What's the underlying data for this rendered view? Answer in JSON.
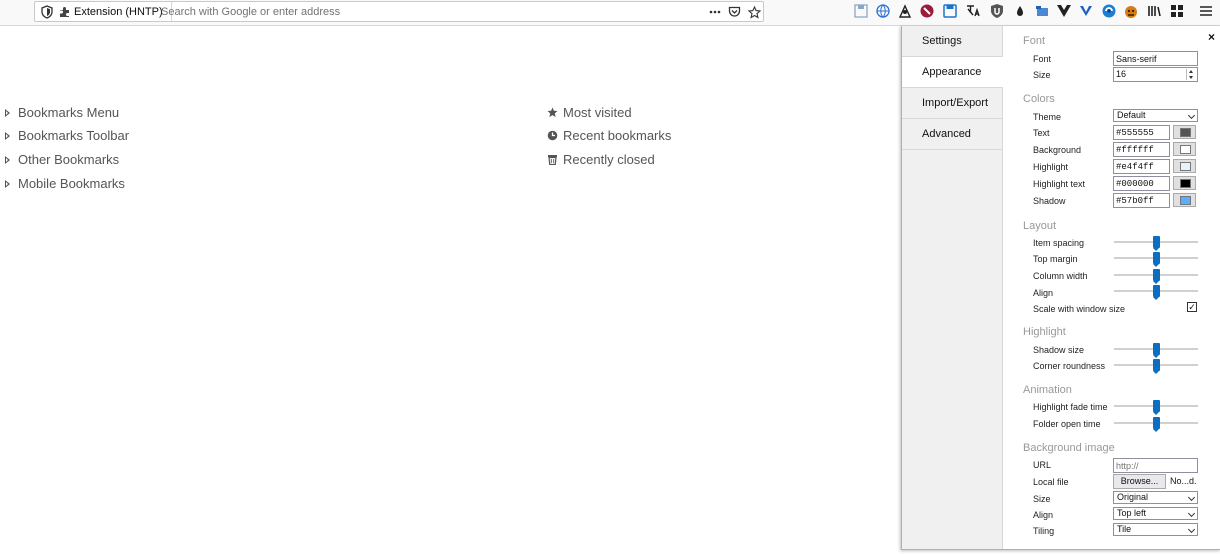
{
  "toolbar": {
    "identity_label": "Extension (HNTP)",
    "url_placeholder": "Search with Google or enter address",
    "icons": [
      "shield-icon",
      "puzzle-icon",
      "more-actions-icon",
      "pocket-icon",
      "star-icon",
      "menu-icon"
    ]
  },
  "bookmarks_left": [
    {
      "label": "Bookmarks Menu"
    },
    {
      "label": "Bookmarks Toolbar"
    },
    {
      "label": "Other Bookmarks"
    },
    {
      "label": "Mobile Bookmarks"
    }
  ],
  "bookmarks_right": [
    {
      "label": "Most visited",
      "icon": "star-icon"
    },
    {
      "label": "Recent bookmarks",
      "icon": "clock-icon"
    },
    {
      "label": "Recently closed",
      "icon": "trash-icon"
    }
  ],
  "panel": {
    "close_label": "×",
    "tabs": [
      {
        "label": "Settings"
      },
      {
        "label": "Appearance",
        "active": true
      },
      {
        "label": "Import/Export"
      },
      {
        "label": "Advanced"
      }
    ],
    "font": {
      "section": "Font",
      "font_label": "Font",
      "font_value": "Sans-serif",
      "size_label": "Size",
      "size_value": "16"
    },
    "colors": {
      "section": "Colors",
      "theme_label": "Theme",
      "theme_value": "Default",
      "items": [
        {
          "label": "Text",
          "value": "#555555",
          "swatch": "#555555"
        },
        {
          "label": "Background",
          "value": "#ffffff",
          "swatch": "#ffffff"
        },
        {
          "label": "Highlight",
          "value": "#e4f4ff",
          "swatch": "#e4f4ff"
        },
        {
          "label": "Highlight text",
          "value": "#000000",
          "swatch": "#000000"
        },
        {
          "label": "Shadow",
          "value": "#57b0ff",
          "swatch": "#57b0ff"
        }
      ]
    },
    "layout": {
      "section": "Layout",
      "items": [
        {
          "label": "Item spacing",
          "level": 0.5
        },
        {
          "label": "Top margin",
          "level": 0.5
        },
        {
          "label": "Column width",
          "level": 0.5
        },
        {
          "label": "Align",
          "level": 0.5
        }
      ],
      "scale_label": "Scale with window size",
      "scale_checked": true
    },
    "highlight": {
      "section": "Highlight",
      "items": [
        {
          "label": "Shadow size",
          "level": 0.5
        },
        {
          "label": "Corner roundness",
          "level": 0.5
        }
      ]
    },
    "animation": {
      "section": "Animation",
      "items": [
        {
          "label": "Highlight fade time",
          "level": 0.5
        },
        {
          "label": "Folder open time",
          "level": 0.5
        }
      ]
    },
    "background_image": {
      "section": "Background image",
      "url_label": "URL",
      "url_placeholder": "http://",
      "local_label": "Local file",
      "browse_label": "Browse...",
      "file_status": "No...d.",
      "size_label": "Size",
      "size_value": "Original",
      "align_label": "Align",
      "align_value": "Top left",
      "tiling_label": "Tiling",
      "tiling_value": "Tile"
    }
  }
}
